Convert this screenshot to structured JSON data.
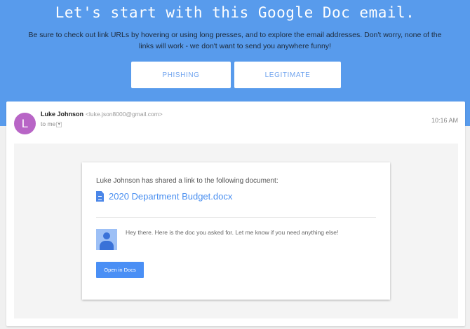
{
  "hero": {
    "title": "Let's start with this Google Doc email.",
    "subtitle": "Be sure to check out link URLs by hovering or using long presses, and to explore the email addresses. Don't worry, none of the links will work - we don't want to send you anywhere funny!",
    "phishing_label": "PHISHING",
    "legitimate_label": "LEGITIMATE"
  },
  "email": {
    "avatar_letter": "L",
    "sender_name": "Luke Johnson",
    "sender_email": "<luke.json8000@gmail.com>",
    "to": "to me",
    "dropdown": "▾",
    "time": "10:16 AM",
    "shared_text": "Luke Johnson has shared a link to the following document:",
    "doc_name": "2020 Department Budget.docx",
    "message": "Hey there. Here is the doc you asked for. Let me know if you need anything else!",
    "open_label": "Open in Docs"
  }
}
